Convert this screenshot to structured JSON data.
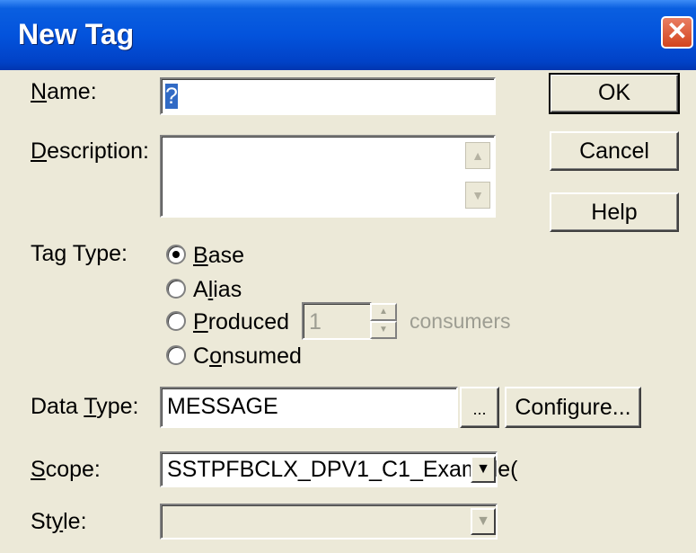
{
  "window": {
    "title": "New Tag",
    "close_glyph": "✕"
  },
  "name": {
    "label_u": "N",
    "label_rest": "ame:",
    "value": "?"
  },
  "description": {
    "label_u": "D",
    "label_rest": "escription:",
    "value": "",
    "scroll_up": "▲",
    "scroll_down": "▼"
  },
  "buttons": {
    "ok": "OK",
    "cancel": "Cancel",
    "help": "Help",
    "browse": "...",
    "configure": "Configure..."
  },
  "tag_type": {
    "label": "Tag Type:",
    "selected": "Base",
    "options": [
      {
        "u": "B",
        "rest": "ase"
      },
      {
        "pre": "A",
        "u": "l",
        "rest": "ias"
      },
      {
        "u": "P",
        "rest": "roduced"
      },
      {
        "pre": "C",
        "u": "o",
        "rest": "nsumed"
      }
    ],
    "consumers_value": "1",
    "consumers_label": "consumers",
    "spin_up": "▲",
    "spin_down": "▼"
  },
  "data_type": {
    "label_pre": "Data ",
    "label_u": "T",
    "label_rest": "ype:",
    "value": "MESSAGE"
  },
  "scope": {
    "label_u": "S",
    "label_rest": "cope:",
    "value": "SSTPFBCLX_DPV1_C1_Example(",
    "arrow": "▼"
  },
  "style": {
    "label_pre": "St",
    "label_u": "y",
    "label_rest": "le:",
    "value": "",
    "arrow": "▼"
  }
}
